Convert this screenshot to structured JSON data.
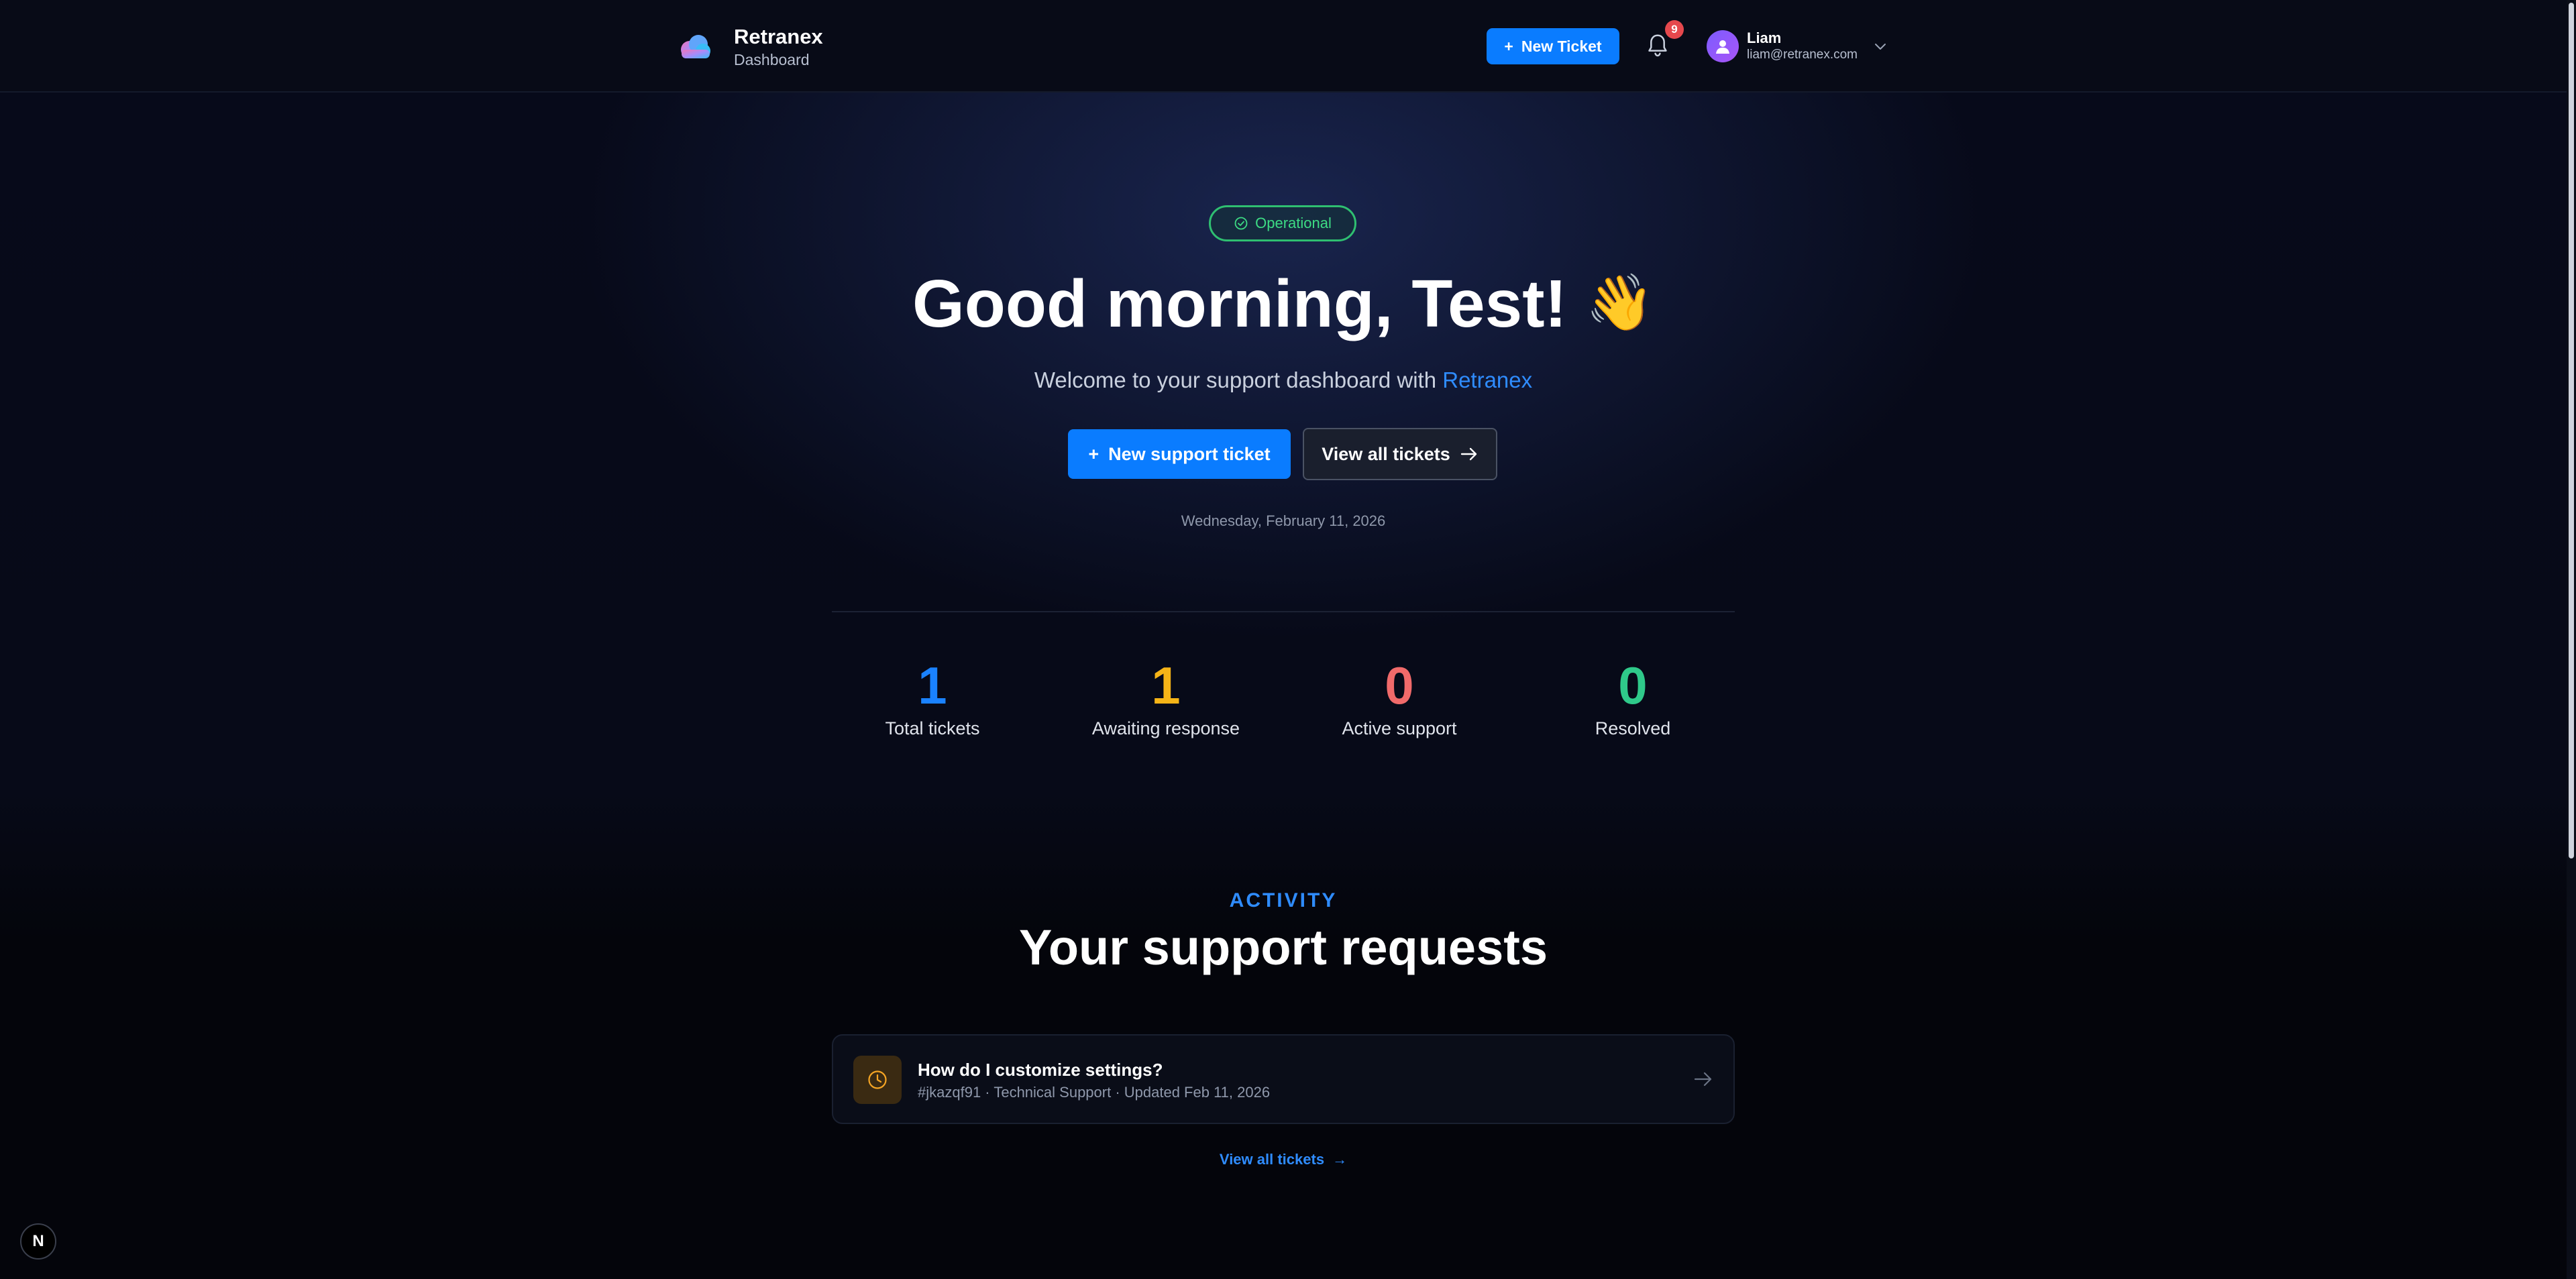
{
  "header": {
    "brand_name": "Retranex",
    "brand_subtitle": "Dashboard",
    "new_ticket_label": "New Ticket",
    "notification_count": "9",
    "user_name": "Liam",
    "user_email": "liam@retranex.com"
  },
  "hero": {
    "status_label": "Operational",
    "greeting": "Good morning, Test!",
    "wave_emoji": "👋",
    "welcome_prefix": "Welcome to your support dashboard with",
    "welcome_brand": "Retranex",
    "primary_button": "New support ticket",
    "secondary_button": "View all tickets",
    "date": "Wednesday, February 11, 2026"
  },
  "stats": [
    {
      "value": "1",
      "label": "Total tickets",
      "color": "#1a82ff"
    },
    {
      "value": "1",
      "label": "Awaiting response",
      "color": "#f5b417"
    },
    {
      "value": "0",
      "label": "Active support",
      "color": "#f06a6a"
    },
    {
      "value": "0",
      "label": "Resolved",
      "color": "#2fc98a"
    }
  ],
  "activity": {
    "eyebrow": "ACTIVITY",
    "title": "Your support requests",
    "tickets": [
      {
        "title": "How do I customize settings?",
        "meta": "#jkazqf91 · Technical Support · Updated Feb 11, 2026",
        "icon": "clock-icon"
      }
    ],
    "view_all_label": "View all tickets"
  },
  "dev_badge": "N",
  "colors": {
    "accent": "#0a7cff",
    "operational": "#3ddc84",
    "background": "#05070f"
  }
}
